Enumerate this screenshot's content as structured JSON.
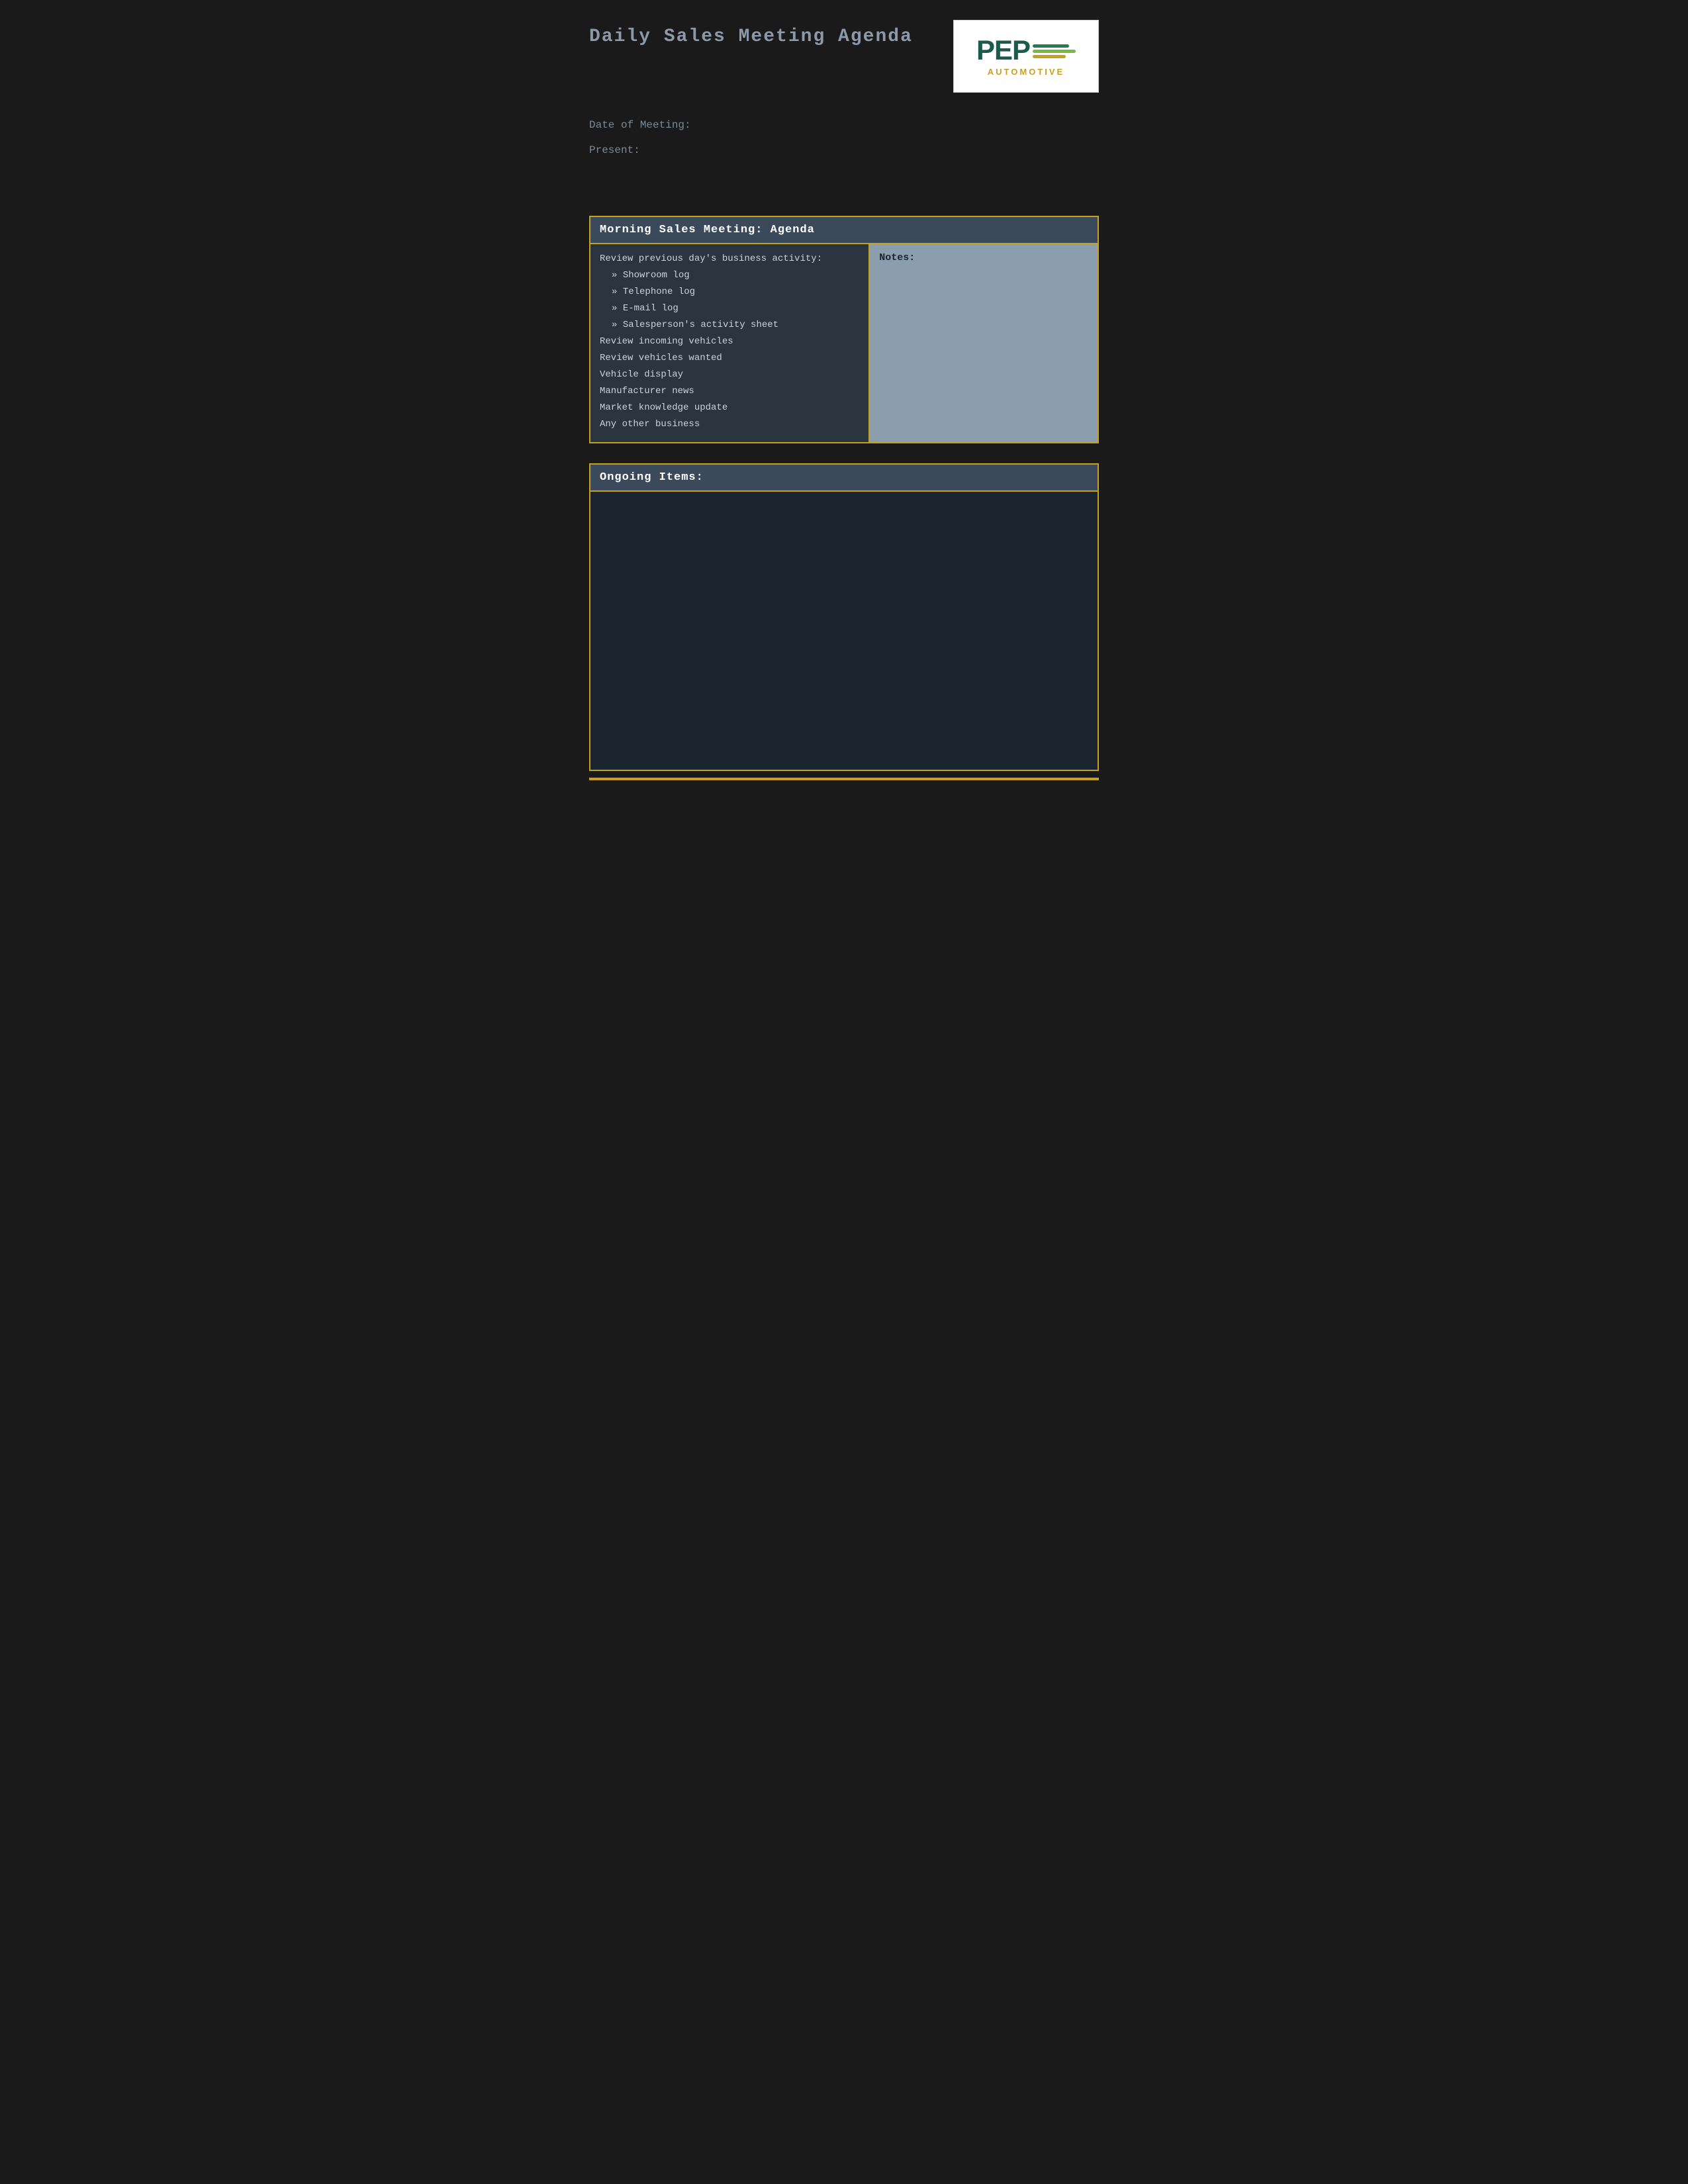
{
  "header": {
    "title": "Daily Sales Meeting Agenda",
    "logo": {
      "company": "PEP",
      "subtitle": "AUTOMOTIVE"
    }
  },
  "meta": {
    "date_label": "Date of Meeting:",
    "present_label": "Present:"
  },
  "morning_meeting": {
    "section_title": "Morning Sales Meeting: Agenda",
    "agenda": {
      "intro": "Review previous day's business activity:",
      "sub_items": [
        "Showroom log",
        "Telephone log",
        "E-mail log",
        "Salesperson's activity sheet"
      ],
      "main_items": [
        "Review incoming vehicles",
        "Review vehicles wanted",
        "Vehicle display",
        "Manufacturer news",
        "Market knowledge update",
        "Any other business"
      ]
    },
    "notes_label": "Notes:"
  },
  "ongoing": {
    "section_title": "Ongoing Items:"
  }
}
